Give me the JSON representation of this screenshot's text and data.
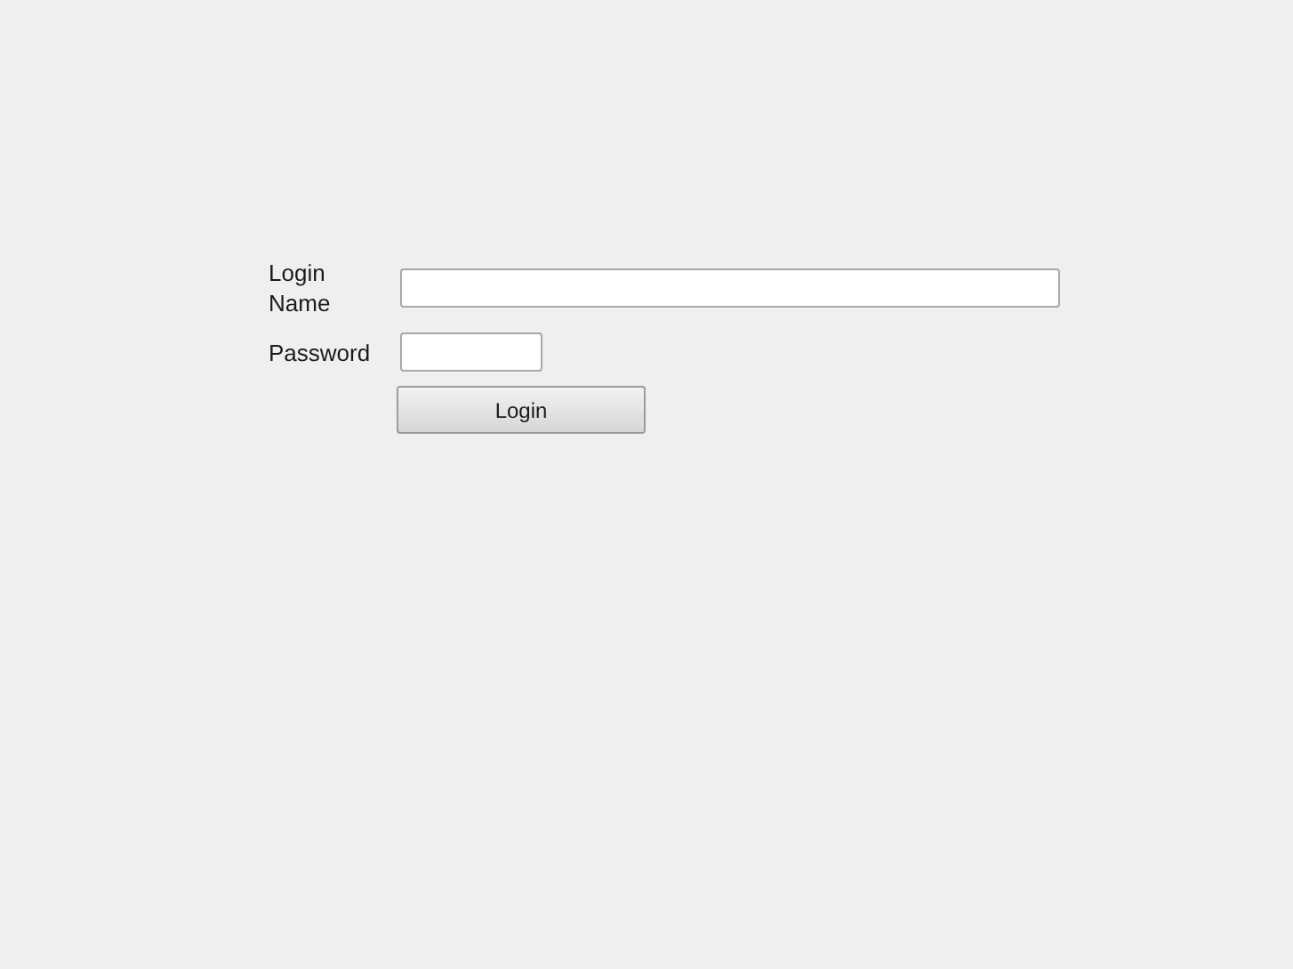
{
  "fields": [
    {
      "label": "Login Name",
      "kind": "wide"
    },
    {
      "label": "Password",
      "kind": "short"
    }
  ],
  "button": "Login"
}
